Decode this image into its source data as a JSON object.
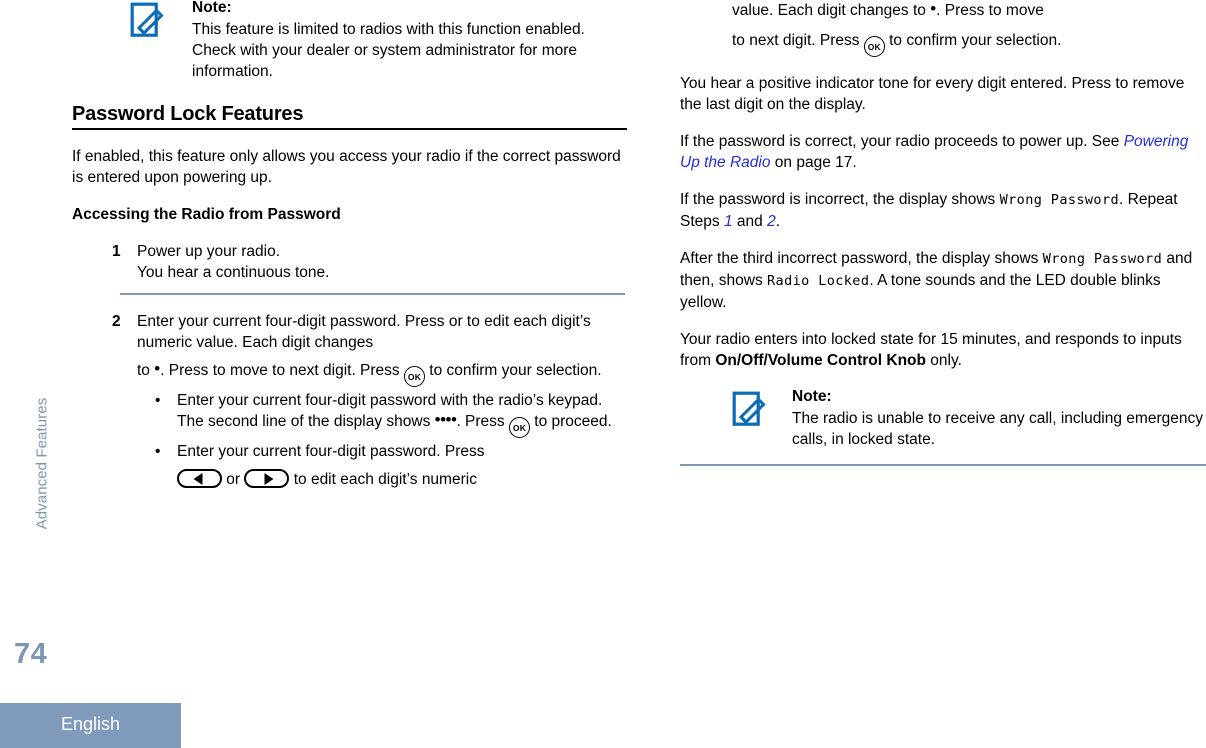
{
  "sidebar": {
    "chapter_label": "Advanced Features",
    "page_number": "74",
    "language": "English",
    "accent_color": "#7d97b3",
    "footer_bg": "#809abb"
  },
  "icons": {
    "note_icon": "note-pencil-icon",
    "note_icon_color": "#0b6cb5",
    "ok_button": "OK",
    "left_arrow": "left-arrow-button",
    "right_arrow": "right-arrow-button",
    "dot": "•",
    "four_dots": "••••"
  },
  "left_column": {
    "note_top": {
      "title": "Note:",
      "text": "This feature is limited to radios with this function enabled. Check with your dealer or system administrator for more information."
    },
    "heading": "Password Lock Features",
    "intro": "If enabled, this feature only allows you access your radio if the correct password is entered upon powering up.",
    "subheading": "Accessing the Radio from Password",
    "step1": {
      "number": "1",
      "text": "Power up your radio.",
      "sub": "You hear a continuous tone."
    },
    "step2": {
      "number": "2",
      "part1": "Enter your current four-digit password. Press or to edit each digit’s numeric value. Each digit changes",
      "part2_pre": "to ",
      "part2_mid": ". Press to move to next digit. Press ",
      "part2_post": " to confirm your selection.",
      "bullets": [
        {
          "marker": "•",
          "pre": "Enter your current four-digit password with the radio’s keypad. The second line of the display shows ",
          "post": ". Press ",
          "tail": " to proceed."
        },
        {
          "marker": "•",
          "pre": "Enter your current four-digit password. Press ",
          "mid": " or ",
          "post": " to edit each digit’s numeric"
        }
      ]
    }
  },
  "right_column": {
    "cont_line1": "value. Each digit changes to ",
    "cont_line1b": ". Press to move",
    "cont_line2_pre": "to next digit. Press ",
    "cont_line2_post": " to confirm your selection.",
    "para_tone": "You hear a positive indicator tone for every digit entered. Press to remove the last digit on the display.",
    "para_correct_pre": "If the password is correct, your radio proceeds to power up. See ",
    "para_correct_link": "Powering Up the Radio",
    "para_correct_post": " on page 17.",
    "para_incorrect_pre": "If the password is incorrect, the display shows ",
    "para_incorrect_lcd": "Wrong Password",
    "para_incorrect_mid": ". Repeat Steps ",
    "para_incorrect_ref1": "1",
    "para_incorrect_and": " and ",
    "para_incorrect_ref2": "2",
    "para_incorrect_end": ".",
    "para_third_pre": "After the third incorrect password, the display shows ",
    "para_third_lcd1": "Wrong Password",
    "para_third_mid": " and then, shows ",
    "para_third_lcd2": "Radio Locked",
    "para_third_post": ". A tone sounds and the LED double blinks yellow.",
    "para_locked_pre": "Your radio enters into locked state for 15 minutes, and responds to inputs from ",
    "para_locked_bold": "On/Off/Volume Control Knob",
    "para_locked_post": " only.",
    "note_bottom": {
      "title": "Note:",
      "text": "The radio is unable to receive any call, including emergency calls, in locked state."
    }
  }
}
